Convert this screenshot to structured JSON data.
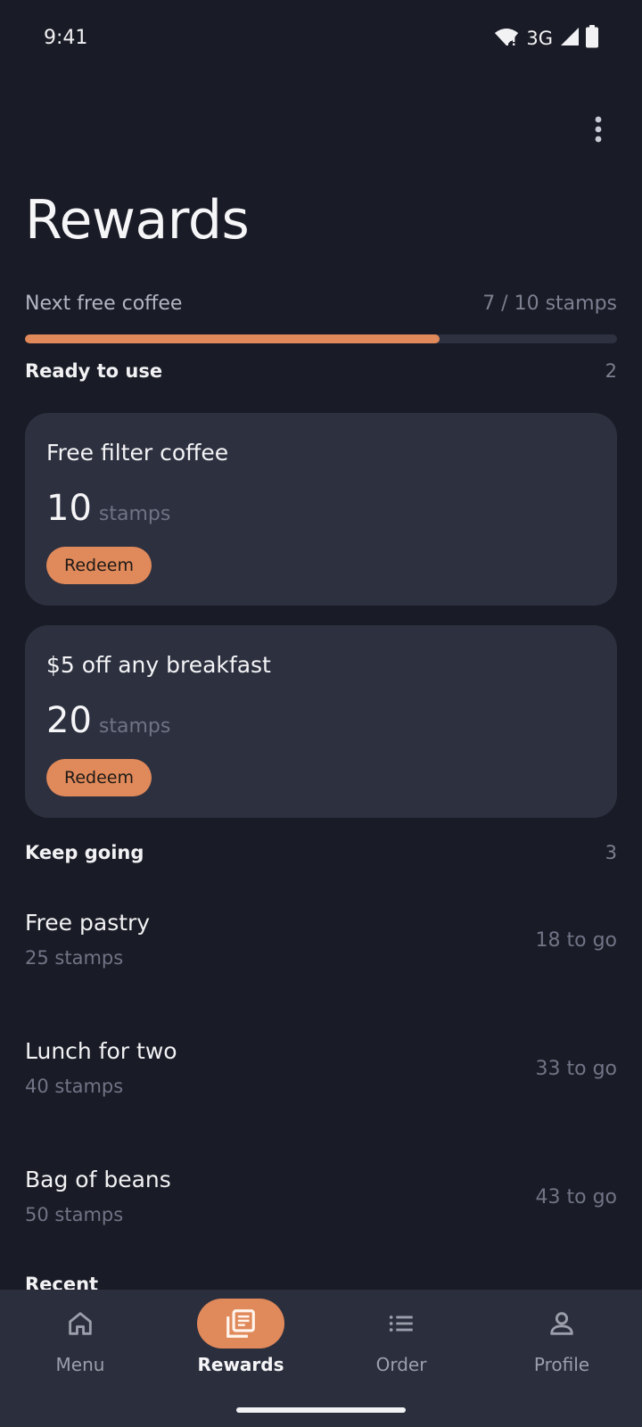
{
  "status_bar": {
    "time": "9:41",
    "network": "3G"
  },
  "header": {
    "title": "Rewards"
  },
  "progress": {
    "label": "Next free coffee",
    "value_text": "7 / 10 stamps",
    "current": 7,
    "total": 10
  },
  "ready": {
    "title": "Ready to use",
    "count": "2",
    "cards": [
      {
        "title": "Free filter coffee",
        "stamps": "10",
        "unit": "stamps",
        "button": "Redeem"
      },
      {
        "title": "$5 off any breakfast",
        "stamps": "20",
        "unit": "stamps",
        "button": "Redeem"
      }
    ]
  },
  "keep_going": {
    "title": "Keep going",
    "count": "3",
    "items": [
      {
        "name": "Free pastry",
        "cost": "25 stamps",
        "to_go": "18 to go"
      },
      {
        "name": "Lunch for two",
        "cost": "40 stamps",
        "to_go": "33 to go"
      },
      {
        "name": "Bag of beans",
        "cost": "50 stamps",
        "to_go": "43 to go"
      }
    ]
  },
  "recent": {
    "title": "Recent"
  },
  "nav": {
    "items": [
      {
        "label": "Menu",
        "icon": "home-icon"
      },
      {
        "label": "Rewards",
        "icon": "rewards-icon",
        "active": true
      },
      {
        "label": "Order",
        "icon": "list-icon"
      },
      {
        "label": "Profile",
        "icon": "person-icon"
      }
    ]
  },
  "colors": {
    "background": "#191b26",
    "accent": "#e0895a",
    "card": "#2c303f",
    "nav": "#2b2f3d"
  }
}
